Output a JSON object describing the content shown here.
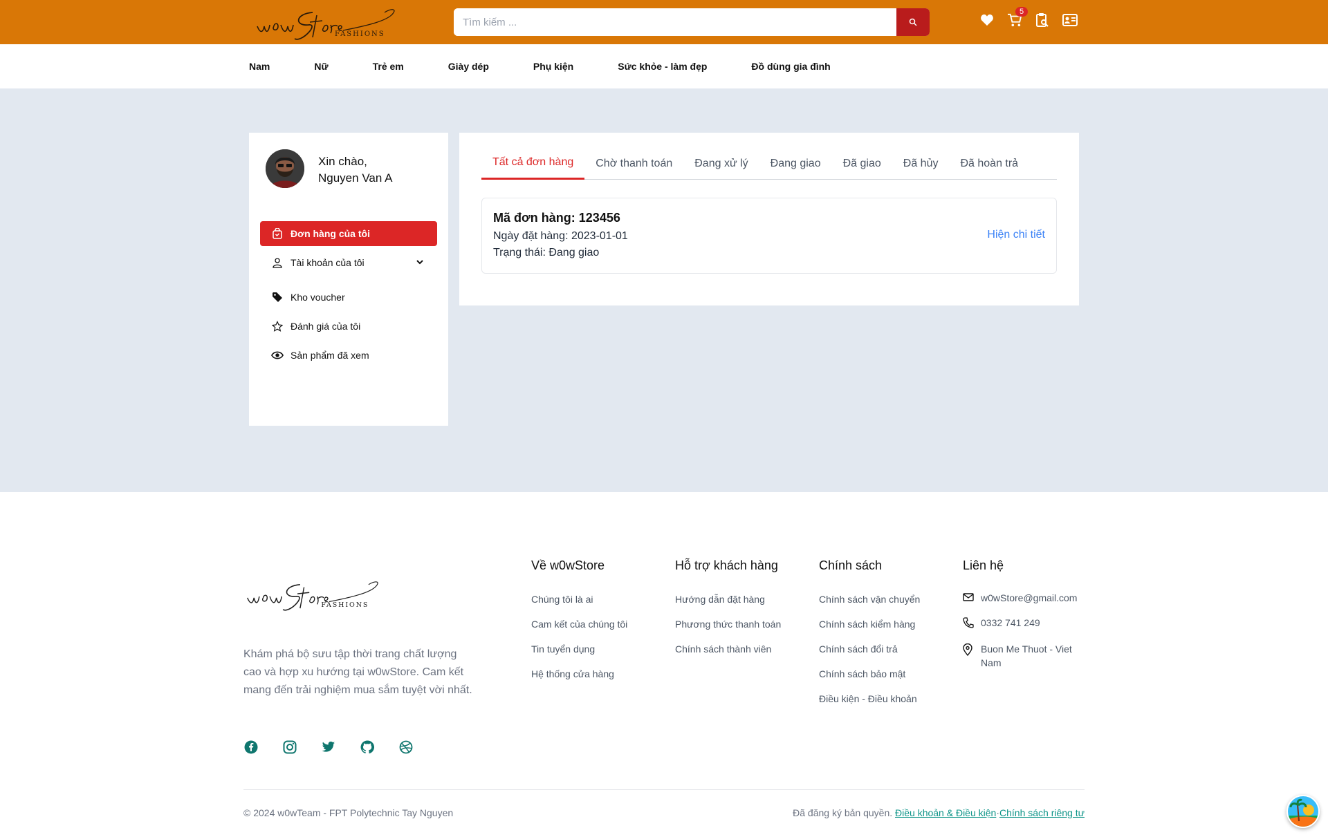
{
  "brand": {
    "logo_script": "w0wStore",
    "logo_sub": "FASHIONS",
    "primary_color": "#d97706",
    "accent_color": "#dc2626"
  },
  "header": {
    "search_placeholder": "Tìm kiếm ...",
    "cart_count": "5",
    "icons": [
      "heart-icon",
      "cart-icon",
      "order-lookup-icon",
      "account-card-icon"
    ]
  },
  "nav": {
    "items": [
      "Nam",
      "Nữ",
      "Trẻ em",
      "Giày dép",
      "Phụ kiện",
      "Sức khỏe - làm đẹp",
      "Đồ dùng gia đình"
    ]
  },
  "sidebar": {
    "greeting": "Xin chào,",
    "user_name": "Nguyen Van A",
    "menu": [
      {
        "label": "Đơn hàng của tôi",
        "icon": "shopping-bag-icon",
        "active": true
      },
      {
        "label": "Tài khoản của tôi",
        "icon": "user-icon",
        "active": false
      },
      {
        "label": "Kho voucher",
        "icon": "tag-icon",
        "active": false
      },
      {
        "label": "Đánh giá của tôi",
        "icon": "star-icon",
        "active": false
      },
      {
        "label": "Sản phẩm đã xem",
        "icon": "eye-icon",
        "active": false
      }
    ]
  },
  "orders": {
    "tabs": [
      "Tất cả đơn hàng",
      "Chờ thanh toán",
      "Đang xử lý",
      "Đang giao",
      "Đã giao",
      "Đã hủy",
      "Đã hoàn trả"
    ],
    "active_tab": "Tất cả đơn hàng",
    "list": [
      {
        "id_text": "Mã đơn hàng: 123456",
        "date_text": "Ngày đặt hàng: 2023-01-01",
        "status_text": "Trạng thái: Đang giao",
        "detail_link": "Hiện chi tiết"
      }
    ]
  },
  "footer": {
    "description": "Khám phá bộ sưu tập thời trang chất lượng cao và hợp xu hướng tại w0wStore. Cam kết mang đến trải nghiệm mua sắm tuyệt vời nhất.",
    "socials": [
      "facebook-icon",
      "instagram-icon",
      "twitter-icon",
      "github-icon",
      "dribbble-icon"
    ],
    "columns": [
      {
        "title": "Về w0wStore",
        "links": [
          "Chúng tôi là ai",
          "Cam kết của chúng tôi",
          "Tin tuyển dụng",
          "Hệ thống cửa hàng"
        ]
      },
      {
        "title": "Hỗ trợ khách hàng",
        "links": [
          "Hướng dẫn đặt hàng",
          "Phương thức thanh toán",
          "Chính sách thành viên"
        ]
      },
      {
        "title": "Chính sách",
        "links": [
          "Chính sách vận chuyển",
          "Chính sách kiểm hàng",
          "Chính sách đổi trả",
          "Chính sách bảo mật",
          "Điều kiện - Điều khoản"
        ]
      }
    ],
    "contact": {
      "title": "Liên hệ",
      "email": "w0wStore@gmail.com",
      "phone": "0332 741 249",
      "address": "Buon Me Thuot - Viet Nam"
    },
    "copyright": "© 2024 w0wTeam - FPT Polytechnic Tay Nguyen",
    "legal_prefix": "Đã đăng ký bản quyền.",
    "legal_terms": "Điều khoản & Điều kiện",
    "legal_sep": "·",
    "legal_privacy": "Chính sách riêng tư"
  }
}
